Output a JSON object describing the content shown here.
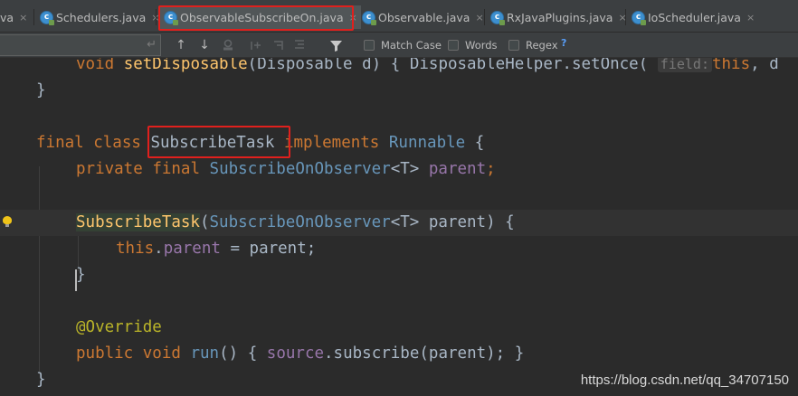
{
  "tabs": [
    {
      "label": "va",
      "icon": "none"
    },
    {
      "label": "Schedulers.java",
      "icon": "java-class-icon"
    },
    {
      "label": "ObservableSubscribeOn.java",
      "icon": "java-class-icon",
      "active": true,
      "annotated": true
    },
    {
      "label": "Observable.java",
      "icon": "java-class-icon"
    },
    {
      "label": "RxJavaPlugins.java",
      "icon": "java-class-icon"
    },
    {
      "label": "IoScheduler.java",
      "icon": "java-class-icon"
    }
  ],
  "close_glyph": "×",
  "find": {
    "query": "",
    "enter_glyph": "↵",
    "prev_glyph": "↑",
    "next_glyph": "↓",
    "match_case": "Match Case",
    "words": "Words",
    "regex": "Regex",
    "help": "?",
    "match_case_checked": false,
    "words_checked": false,
    "regex_checked": false
  },
  "code": {
    "line1": {
      "kw": "void",
      "method": "setDisposable",
      "p_open": "(",
      "ptype": "Disposable",
      "pname": " d",
      "p_close": ")",
      "brace": "{",
      "helper": "DisposableHelper",
      "call": ".setOnce(",
      "hint": "field:",
      "thiskw": "this",
      "rest": ", d"
    },
    "line2": {
      "brace": "}"
    },
    "line4": {
      "kw1": "final",
      "kw2": "class",
      "name": "SubscribeTask",
      "kw3": "implements",
      "iface": "Runnable",
      "brace": "{"
    },
    "line5": {
      "kw1": "private",
      "kw2": "final",
      "type": "SubscribeOnObserver",
      "generic": "<T>",
      "field": "parent",
      "semi": ";"
    },
    "line7": {
      "ctor": "SubscribeTask",
      "p_open": "(",
      "type": "SubscribeOnObserver",
      "generic": "<T>",
      "pname": " parent",
      "p_close": ")",
      "brace": "{"
    },
    "line8": {
      "thiskw": "this",
      "dot": ".",
      "field": "parent",
      "rest": " = parent;"
    },
    "line9": {
      "brace": "}"
    },
    "line11": {
      "annotation": "@Override"
    },
    "line12": {
      "kw1": "public",
      "kw2": "void",
      "method": "run",
      "parens": "()",
      "brace_open": "{",
      "src": "source",
      "call": ".subscribe(",
      "arg": "parent",
      "tail": ");",
      "brace_close": "}"
    },
    "line13": {
      "brace": "}"
    }
  },
  "watermark": "https://blog.csdn.net/qq_34707150",
  "colors": {
    "annotation_box": "#e0201d",
    "keyword": "#cc7832",
    "field": "#9876aa",
    "method": "#ffc66d",
    "interface": "#6897bb"
  }
}
